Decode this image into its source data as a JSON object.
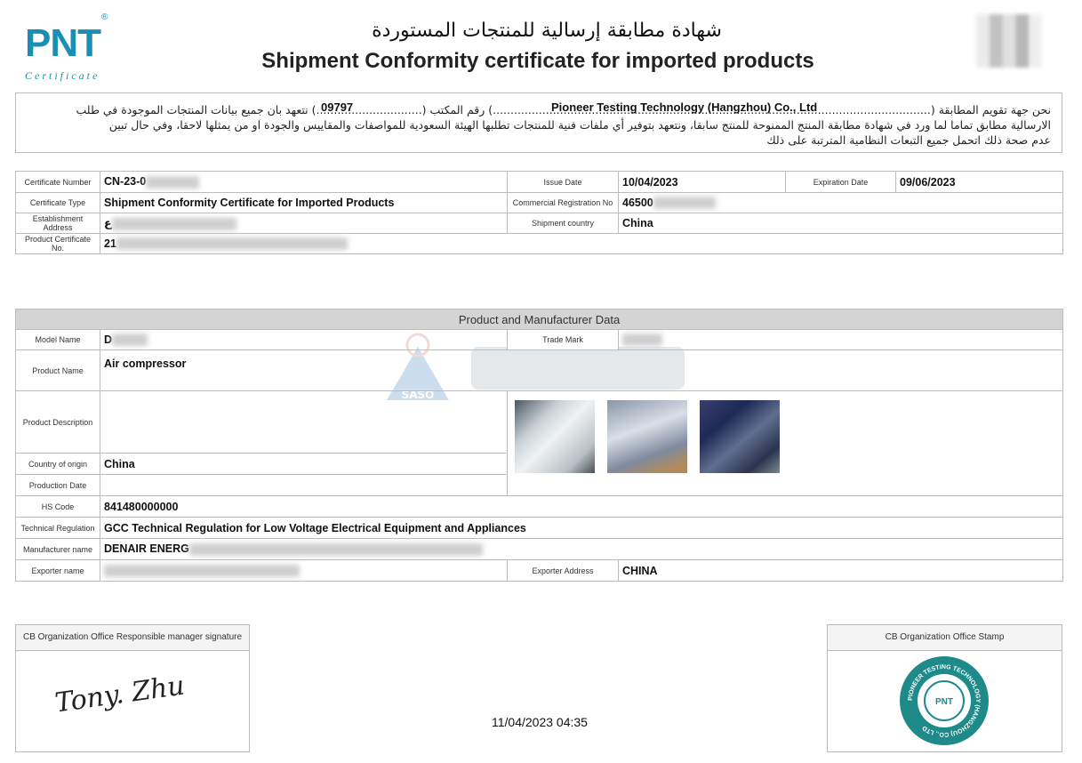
{
  "header": {
    "logo_text": "PNT",
    "logo_sub": "Certificate",
    "logo_reg": "®",
    "title_ar": "شهادة مطابقة إرسالية للمنتجات المستوردة",
    "title_en": "Shipment Conformity certificate for imported products"
  },
  "declaration": {
    "line1": "نحن جهة تقويم المطابقة (............................................................................................................................) رقم المكتب (..............................) نتعهد بان جميع بيانات المنتجات الموجودة في طلب",
    "line2": "الارسالية مطابق تماما لما ورد في شهادة مطابقة المنتج الممنوحة للمنتج سابقا، ونتعهد بتوفير أي ملفات فنية للمنتجات تطلبها الهيئة السعودية للمواصفات والمقاييس والجودة او من يمثلها لاحقا، وفي حال تبين",
    "line3": "عدم صحة ذلك اتحمل جميع التبعات النظامية المترتبة على ذلك",
    "company": "Pioneer Testing Technology (Hangzhou) Co., Ltd",
    "office_no": "09797"
  },
  "certificate": {
    "number_label": "Certificate Number",
    "number_value": "CN-23-0",
    "issue_label": "Issue Date",
    "issue_value": "10/04/2023",
    "expiry_label": "Expiration Date",
    "expiry_value": "09/06/2023",
    "type_label": "Certificate Type",
    "type_value": "Shipment Conformity Certificate for Imported Products",
    "crn_label": "Commercial Registration No",
    "crn_value": "46500",
    "est_label": "Establishment Address",
    "est_value": "ع",
    "country_label": "Shipment country",
    "country_value": "China",
    "pcn_label": "Product Certificate No.",
    "pcn_value": "21"
  },
  "product": {
    "section_title": "Product and Manufacturer Data",
    "model_label": "Model Name",
    "model_value": "D",
    "trade_label": "Trade Mark",
    "name_label": "Product Name",
    "name_value": "Air compressor",
    "desc_label": "Product Description",
    "origin_label": "Country of origin",
    "origin_value": "China",
    "prod_date_label": "Production Date",
    "hs_label": "HS Code",
    "hs_value": "841480000000",
    "tech_label": "Technical Regulation",
    "tech_value": "GCC Technical Regulation for Low Voltage Electrical Equipment and Appliances",
    "mfr_label": "Manufacturer name",
    "mfr_value": "DENAIR ENERG",
    "exporter_label": "Exporter name",
    "exp_addr_label": "Exporter Address",
    "exp_addr_value": "CHINA"
  },
  "watermark": {
    "text": "SASO"
  },
  "footer": {
    "signature_label": "CB Organization Office Responsible manager signature",
    "signature_text": "Tony. Zhu",
    "stamp_label": "CB Organization Office Stamp",
    "stamp_text": "PIONEER TESTING TECHNOLOGY (HANGZHOU) CO., LTD",
    "stamp_center": "PNT",
    "datetime": "11/04/2023 04:35"
  },
  "colors": {
    "brand": "#1b8fb3",
    "stamp": "#1f8a8a",
    "section_bg": "#d4d4d4"
  }
}
